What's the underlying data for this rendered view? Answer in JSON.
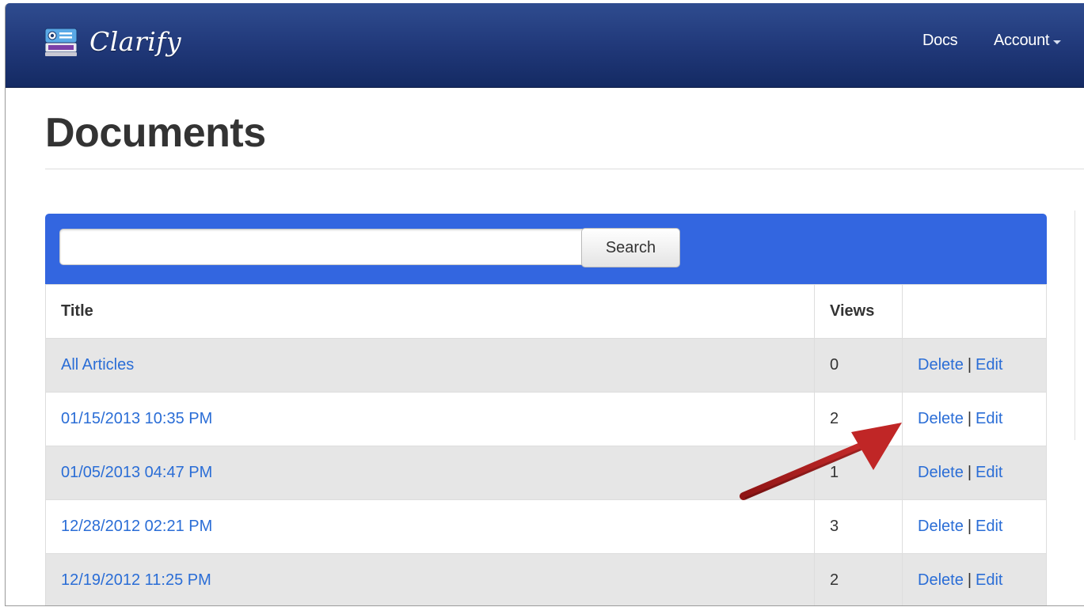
{
  "app": {
    "name": "Clarify",
    "icon": "camera-logo-icon"
  },
  "navbar": {
    "docs_label": "Docs",
    "account_label": "Account"
  },
  "page": {
    "title": "Documents"
  },
  "search": {
    "value": "",
    "button_label": "Search"
  },
  "table": {
    "columns": [
      "Title",
      "Views",
      ""
    ],
    "rows": [
      {
        "title": "All Articles",
        "views": "0",
        "delete": "Delete",
        "edit": "Edit"
      },
      {
        "title": "01/15/2013 10:35 PM",
        "views": "2",
        "delete": "Delete",
        "edit": "Edit"
      },
      {
        "title": "01/05/2013 04:47 PM",
        "views": "1",
        "delete": "Delete",
        "edit": "Edit"
      },
      {
        "title": "12/28/2012 02:21 PM",
        "views": "3",
        "delete": "Delete",
        "edit": "Edit"
      },
      {
        "title": "12/19/2012 11:25 PM",
        "views": "2",
        "delete": "Delete",
        "edit": "Edit"
      }
    ],
    "separator": "|"
  },
  "annotation": {
    "icon": "red-arrow-icon",
    "color": "#b01e1e"
  },
  "colors": {
    "navbar": "#21397a",
    "search_bar": "#3366e0",
    "link": "#2a6dd6",
    "stripe": "#e6e6e6"
  }
}
